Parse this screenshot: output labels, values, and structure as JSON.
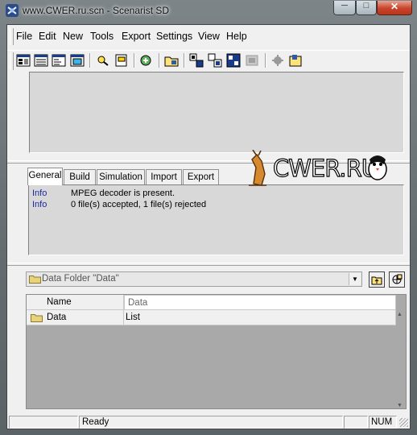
{
  "window": {
    "title": "www.CWER.ru.scn - Scenarist SD"
  },
  "controls": {
    "minimize": "─",
    "maximize": "□",
    "close": "✕"
  },
  "menu": {
    "items": [
      "File",
      "Edit",
      "New",
      "Tools",
      "Export",
      "Settings",
      "View",
      "Help"
    ]
  },
  "toolbar": {
    "icons": [
      "layout-view-icon",
      "table-view-icon",
      "list-view-icon",
      "monitor-icon",
      "find-icon",
      "properties-icon",
      "compile-icon",
      "open-folder-icon",
      "add-track-icon",
      "add-item-icon",
      "link-icon",
      "disabled-icon",
      "settings-disabled-icon",
      "import-icon"
    ]
  },
  "output": {
    "tabs": [
      "General",
      "Build",
      "Simulation",
      "Import",
      "Export"
    ],
    "active_tab": "General",
    "messages": [
      {
        "type": "Info",
        "text": "MPEG decoder is present."
      },
      {
        "type": "Info",
        "text": "0 file(s) accepted, 1 file(s) rejected"
      }
    ]
  },
  "watermark": {
    "text": "CWER.RU"
  },
  "data_panel": {
    "folder_combo": "Data Folder \"Data\"",
    "grid": {
      "header": {
        "name": "Name",
        "value": "Data"
      },
      "rows": [
        {
          "name": "Data",
          "value": "List"
        }
      ]
    }
  },
  "status": {
    "text": "Ready",
    "num": "NUM"
  },
  "colors": {
    "info_text": "#1c2aa0",
    "panel_bg": "#d8d8d8",
    "grid_bg": "#a9a9a9"
  }
}
